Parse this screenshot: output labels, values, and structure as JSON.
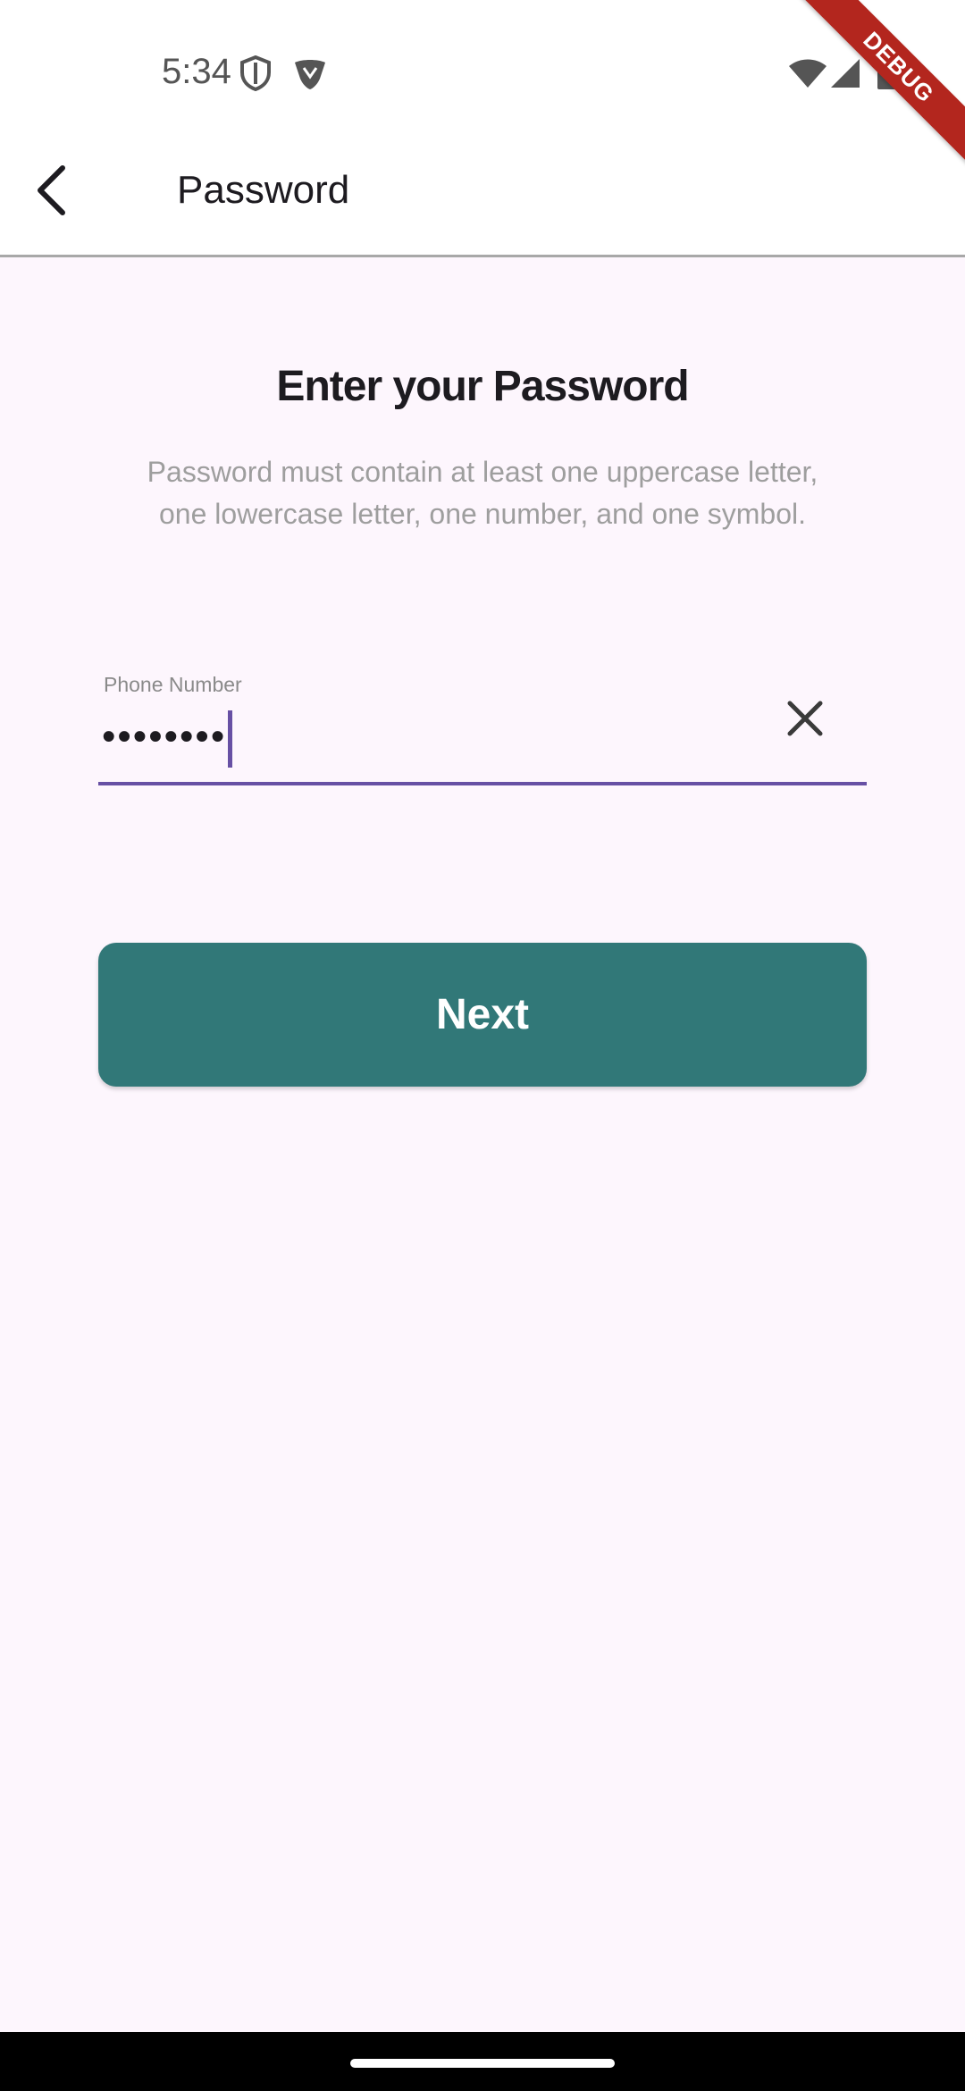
{
  "status_bar": {
    "time": "5:34",
    "icons": [
      "shield-icon",
      "vpn-icon",
      "wifi-icon",
      "signal-icon",
      "battery-icon"
    ]
  },
  "app_bar": {
    "title": "Password",
    "back_icon": "chevron-left-icon"
  },
  "debug_banner": "DEBUG",
  "heading": "Enter your Password",
  "subtext": "Password must contain at least one uppercase letter, one lowercase letter, one number, and one symbol.",
  "password_field": {
    "label": "Phone Number",
    "masked_value": "••••••••",
    "clear_icon": "close-icon"
  },
  "next_button": {
    "label": "Next"
  },
  "colors": {
    "background": "#fdf6fd",
    "accent": "#6750a4",
    "button": "#317878",
    "debug_ribbon": "#b3261e"
  }
}
